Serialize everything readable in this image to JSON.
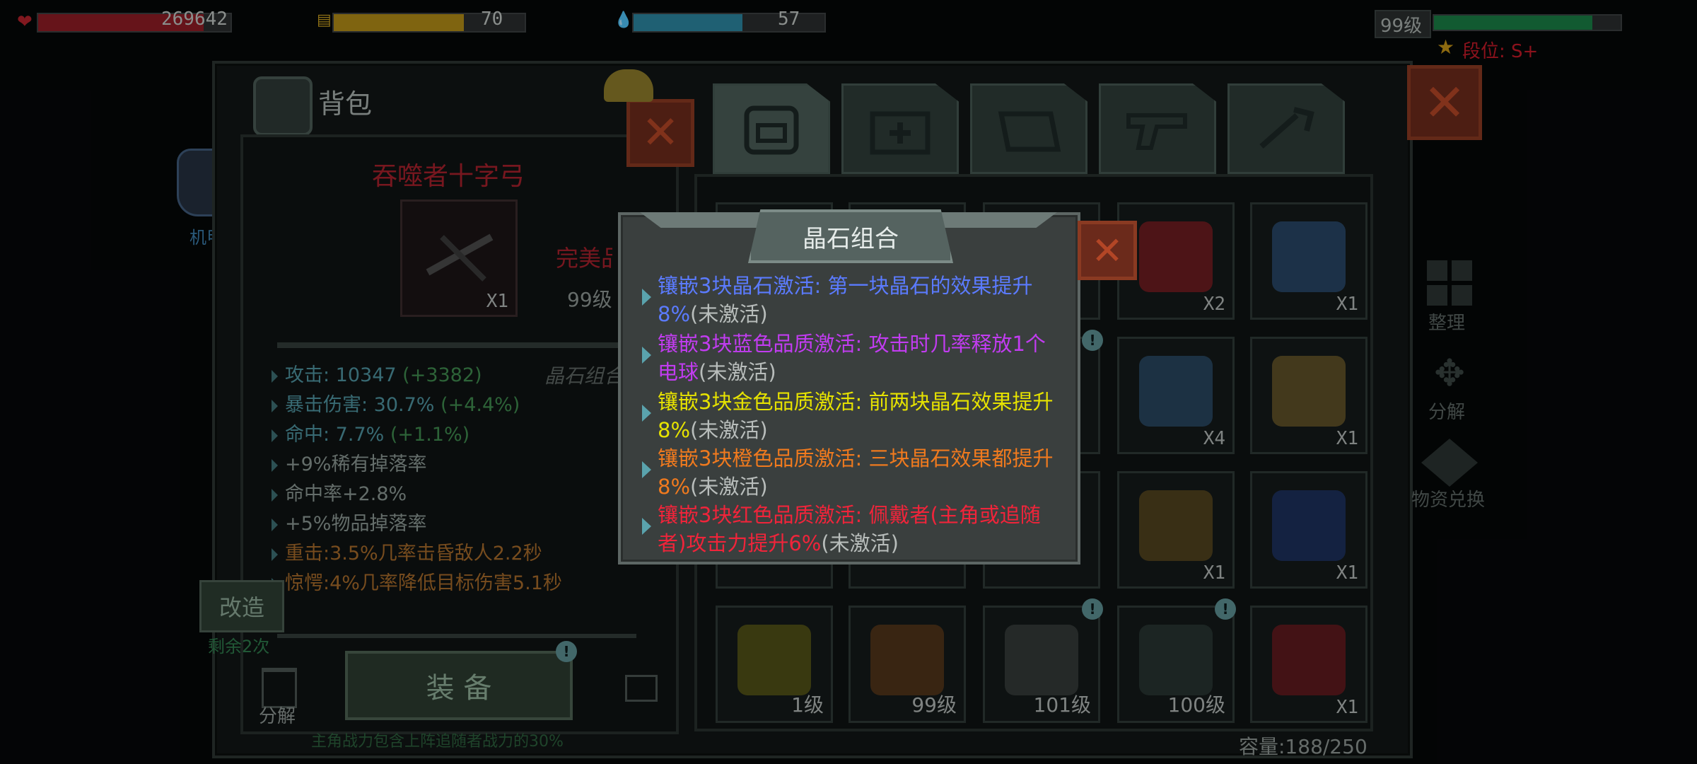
{
  "hud": {
    "hp": {
      "value": "269642",
      "fill_fraction": 0.86,
      "color": "#b3222b"
    },
    "energy": {
      "value": "70",
      "fill_fraction": 0.68,
      "color": "#c59d1f"
    },
    "shield": {
      "value": "57",
      "fill_fraction": 0.57,
      "color": "#3aa0bd"
    },
    "level": {
      "label": "99级",
      "fill_fraction": 0.85,
      "color": "#1b8f4c"
    },
    "rank": "段位: S+"
  },
  "side_left": {
    "mech_label": "机甲"
  },
  "backpack": {
    "title": "背包",
    "item_name": "吞噬者十字弓",
    "item_count": "X1",
    "quality_partial": "完美品",
    "level_partial": "99级",
    "crystal_partial": "晶石组合",
    "stats": [
      {
        "label": "攻击: 10347",
        "bonus": "(+3382)",
        "color": "#4e93a0"
      },
      {
        "label": "暴击伤害: 30.7%",
        "bonus": "(+4.4%)",
        "color": "#4e93a0"
      },
      {
        "label": "命中: 7.7%",
        "bonus": "(+1.1%)",
        "color": "#4e93a0"
      },
      {
        "label": "+9%稀有掉落率",
        "bonus": "",
        "color": "#8b9894"
      },
      {
        "label": "命中率+2.8%",
        "bonus": "",
        "color": "#8b9894"
      },
      {
        "label": "+5%物品掉落率",
        "bonus": "",
        "color": "#8b9894"
      },
      {
        "label": "重击:3.5%几率击昏敌人2.2秒",
        "bonus": "",
        "color": "#a66a2a"
      },
      {
        "label": "惊愕:4%几率降低目标伤害5.1秒",
        "bonus": "",
        "color": "#a66a2a"
      }
    ],
    "modify_button": "改造",
    "remaining": "剩余2次",
    "equip_button": "装 备",
    "dismantle": "分解",
    "footer_note": "主角战力包含上阵追随者战力的30%"
  },
  "tabs": [
    "backpack",
    "medkit",
    "food",
    "weapon",
    "tools"
  ],
  "right_side": {
    "sort": "整理",
    "dismantle": "分解",
    "exchange": "物资兑换"
  },
  "grid_items": [
    {
      "label": "X2",
      "type": "count"
    },
    {
      "label": "X1",
      "type": "count"
    },
    {
      "label": "X4",
      "type": "count"
    },
    {
      "label": "X1",
      "type": "count"
    },
    {
      "label": "X1",
      "type": "count"
    },
    {
      "label": "X1",
      "type": "count"
    },
    {
      "label": "1级",
      "type": "level"
    },
    {
      "label": "99级",
      "type": "level"
    },
    {
      "label": "101级",
      "type": "level"
    },
    {
      "label": "100级",
      "type": "level"
    },
    {
      "label": "X1",
      "type": "count"
    }
  ],
  "capacity": "容量:188/250",
  "popup": {
    "title": "晶石组合",
    "combos": [
      {
        "text": "镶嵌3块晶石激活: 第一块晶石的效果提升8%",
        "status": "(未激活)",
        "color": "#5b7bff"
      },
      {
        "text": "镶嵌3块蓝色品质激活: 攻击时几率释放1个电球",
        "status": "(未激活)",
        "color": "#c13cf0"
      },
      {
        "text": "镶嵌3块金色品质激活: 前两块晶石效果提升8%",
        "status": "(未激活)",
        "color": "#e6e200"
      },
      {
        "text": "镶嵌3块橙色品质激活: 三块晶石效果都提升8%",
        "status": "(未激活)",
        "color": "#f07a1e"
      },
      {
        "text": "镶嵌3块红色品质激活: 佩戴者(主角或追随者)攻击力提升6%",
        "status": "(未激活)",
        "color": "#f0243a"
      }
    ]
  }
}
